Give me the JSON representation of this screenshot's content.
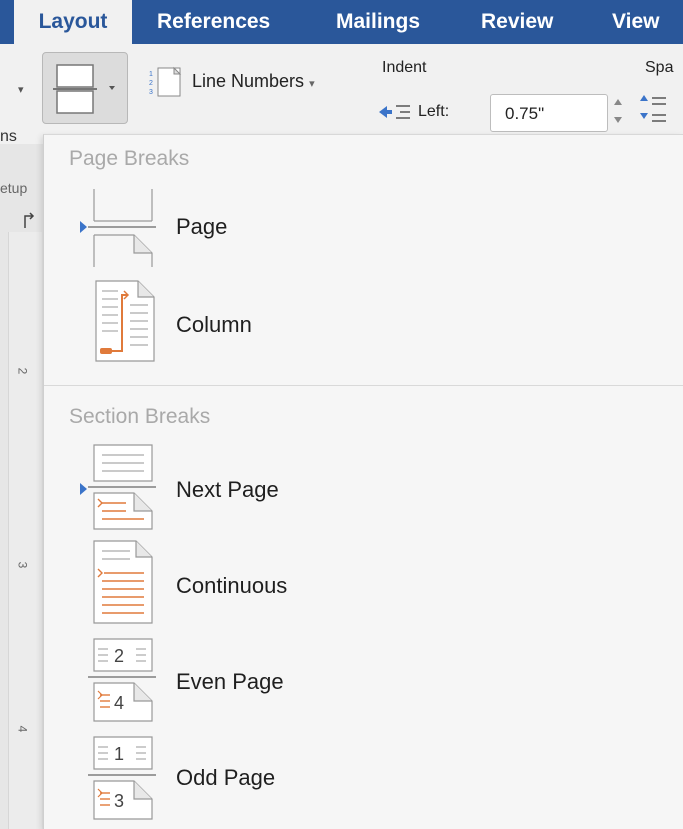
{
  "tabs": [
    {
      "id": "layout",
      "label": "Layout",
      "active": true
    },
    {
      "id": "references",
      "label": "References",
      "active": false
    },
    {
      "id": "mailings",
      "label": "Mailings",
      "active": false
    },
    {
      "id": "review",
      "label": "Review",
      "active": false
    },
    {
      "id": "view",
      "label": "View",
      "active": false
    }
  ],
  "ribbon": {
    "line_numbers_label": "Line Numbers",
    "indent_label": "Indent",
    "spacing_label": "Spa",
    "left_label": "Left:",
    "left_value": "0.75\"",
    "clipped_left_top": "ns",
    "clipped_left_bottom": "etup"
  },
  "ruler_numbers": [
    "2",
    "3",
    "4"
  ],
  "menu": {
    "page_breaks_header": "Page Breaks",
    "section_breaks_header": "Section Breaks",
    "items": [
      {
        "label": "Page",
        "icon": "page-break-icon"
      },
      {
        "label": "Column",
        "icon": "column-break-icon"
      },
      {
        "label": "Next Page",
        "icon": "next-page-icon"
      },
      {
        "label": "Continuous",
        "icon": "continuous-icon"
      },
      {
        "label": "Even Page",
        "icon": "even-page-icon",
        "icon_top_num": "2",
        "icon_bottom_num": "4"
      },
      {
        "label": "Odd Page",
        "icon": "odd-page-icon",
        "icon_top_num": "1",
        "icon_bottom_num": "3"
      }
    ]
  },
  "colors": {
    "ribbon_blue": "#2a579a",
    "accent_orange": "#e07a3b",
    "marker_blue": "#3b74c9"
  }
}
